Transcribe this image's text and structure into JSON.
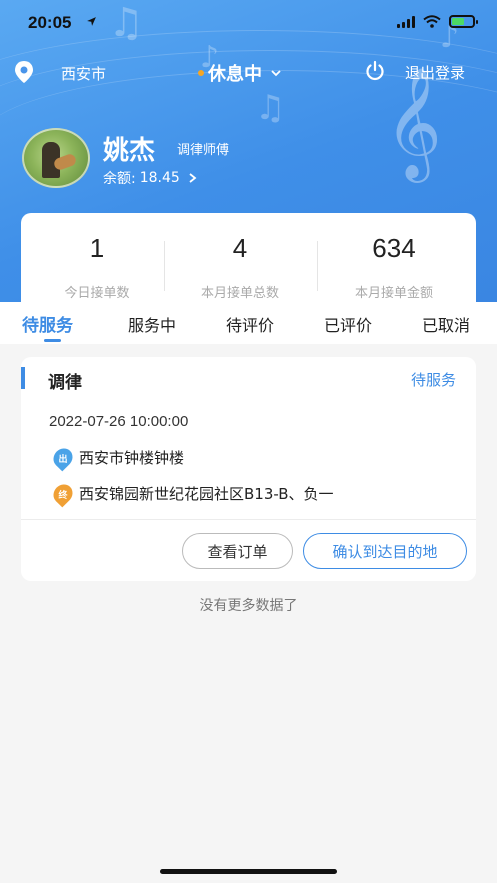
{
  "status_bar": {
    "time": "20:05"
  },
  "header": {
    "city": "西安市",
    "state": "休息中",
    "logout": "退出登录"
  },
  "profile": {
    "name": "姚杰",
    "role": "调律师傅",
    "balance_label": "余额:",
    "balance_value": "18.45"
  },
  "stats": [
    {
      "value": "1",
      "label": "今日接单数"
    },
    {
      "value": "4",
      "label": "本月接单总数"
    },
    {
      "value": "634",
      "label": "本月接单金额"
    }
  ],
  "tabs": [
    {
      "label": "待服务",
      "active": true
    },
    {
      "label": "服务中"
    },
    {
      "label": "待评价"
    },
    {
      "label": "已评价"
    },
    {
      "label": "已取消"
    }
  ],
  "order": {
    "title": "调律",
    "status": "待服务",
    "time": "2022-07-26 10:00:00",
    "start_badge": "出",
    "start": "西安市钟楼钟楼",
    "end_badge": "终",
    "end": "西安锦园新世纪花园社区B13-B、负一",
    "view_button": "查看订单",
    "confirm_button": "确认到达目的地"
  },
  "footer_text": "没有更多数据了",
  "colors": {
    "accent": "#3e8ce4",
    "state_dot": "#f6a623",
    "start_icon": "#4aa3e8",
    "end_icon": "#f0a035"
  }
}
